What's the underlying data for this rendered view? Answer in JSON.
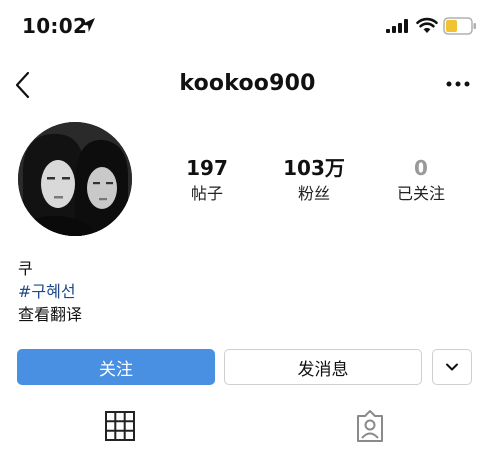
{
  "status_bar": {
    "time": "10:02",
    "icons": [
      "location-arrow-icon",
      "cellular-signal-icon",
      "wifi-icon",
      "battery-icon"
    ],
    "battery_color": "#f1c232"
  },
  "nav": {
    "back_icon": "chevron-left-icon",
    "title": "kookoo900",
    "more_icon": "ellipsis-icon"
  },
  "profile": {
    "avatar_icon": "profile-photo",
    "stats": [
      {
        "value": "197",
        "label": "帖子"
      },
      {
        "value": "103万",
        "label": "粉丝"
      },
      {
        "value": "0",
        "label": "已关注"
      }
    ],
    "bio": {
      "line1": "쿠",
      "hashtag": "#구혜선",
      "translate": "查看翻译"
    }
  },
  "actions": {
    "follow_label": "关注",
    "message_label": "发消息",
    "more_icon": "chevron-down-icon",
    "accent_color": "#4a90e2"
  },
  "tabs": {
    "items": [
      "grid-icon",
      "tagged-person-icon"
    ]
  }
}
